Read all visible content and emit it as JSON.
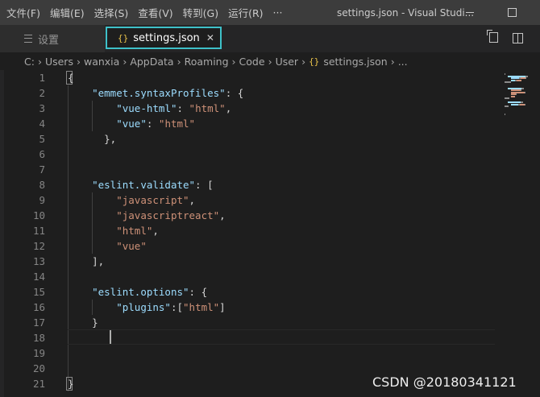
{
  "menu": [
    "文件(F)",
    "编辑(E)",
    "选择(S)",
    "查看(V)",
    "转到(G)",
    "运行(R)",
    "···"
  ],
  "window_title": "settings.json - Visual Studi...",
  "tabs": [
    {
      "label": "设置",
      "icon": "list-icon"
    },
    {
      "label": "settings.json",
      "icon": "json-braces-icon",
      "active": true
    }
  ],
  "breadcrumb": [
    "C:",
    "Users",
    "wanxia",
    "AppData",
    "Roaming",
    "Code",
    "User",
    "settings.json",
    "..."
  ],
  "editor": {
    "line_numbers": [
      "1",
      "2",
      "3",
      "4",
      "5",
      "6",
      "7",
      "8",
      "9",
      "10",
      "11",
      "12",
      "13",
      "14",
      "15",
      "16",
      "17",
      "18",
      "19",
      "20",
      "21"
    ],
    "lines": [
      [
        {
          "t": "{",
          "c": "p"
        }
      ],
      [
        {
          "t": "    ",
          "c": "p"
        },
        {
          "t": "\"emmet.syntaxProfiles\"",
          "c": "k"
        },
        {
          "t": ": {",
          "c": "p"
        }
      ],
      [
        {
          "t": "        ",
          "c": "p"
        },
        {
          "t": "\"vue-html\"",
          "c": "k"
        },
        {
          "t": ": ",
          "c": "p"
        },
        {
          "t": "\"html\"",
          "c": "s"
        },
        {
          "t": ",",
          "c": "p"
        }
      ],
      [
        {
          "t": "        ",
          "c": "p"
        },
        {
          "t": "\"vue\"",
          "c": "k"
        },
        {
          "t": ": ",
          "c": "p"
        },
        {
          "t": "\"html\"",
          "c": "s"
        }
      ],
      [
        {
          "t": "      },",
          "c": "p"
        }
      ],
      [],
      [],
      [
        {
          "t": "    ",
          "c": "p"
        },
        {
          "t": "\"eslint.validate\"",
          "c": "k"
        },
        {
          "t": ": [",
          "c": "p"
        }
      ],
      [
        {
          "t": "        ",
          "c": "p"
        },
        {
          "t": "\"javascript\"",
          "c": "s"
        },
        {
          "t": ",",
          "c": "p"
        }
      ],
      [
        {
          "t": "        ",
          "c": "p"
        },
        {
          "t": "\"javascriptreact\"",
          "c": "s"
        },
        {
          "t": ",",
          "c": "p"
        }
      ],
      [
        {
          "t": "        ",
          "c": "p"
        },
        {
          "t": "\"html\"",
          "c": "s"
        },
        {
          "t": ",",
          "c": "p"
        }
      ],
      [
        {
          "t": "        ",
          "c": "p"
        },
        {
          "t": "\"vue\"",
          "c": "s"
        }
      ],
      [
        {
          "t": "    ],",
          "c": "p"
        }
      ],
      [],
      [
        {
          "t": "    ",
          "c": "p"
        },
        {
          "t": "\"eslint.options\"",
          "c": "k"
        },
        {
          "t": ": {",
          "c": "p"
        }
      ],
      [
        {
          "t": "        ",
          "c": "p"
        },
        {
          "t": "\"plugins\"",
          "c": "k"
        },
        {
          "t": ":[",
          "c": "p"
        },
        {
          "t": "\"html\"",
          "c": "s"
        },
        {
          "t": "]",
          "c": "p"
        }
      ],
      [
        {
          "t": "    }",
          "c": "p"
        }
      ],
      [],
      [],
      [],
      [
        {
          "t": "}",
          "c": "p"
        }
      ]
    ]
  },
  "watermark": "CSDN @20180341121",
  "colors": {
    "background": "#1e1e1e",
    "titlebar": "#3c3c3c",
    "active_tab_border": "#3ec1c9",
    "key": "#9cdcfe",
    "string": "#ce9178",
    "json_icon": "#e8c24a"
  }
}
